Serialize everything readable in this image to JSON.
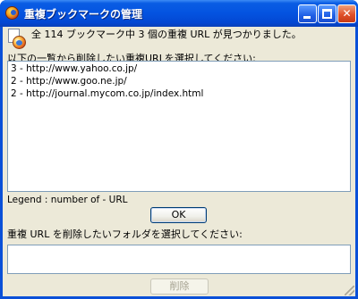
{
  "window": {
    "title": "重複ブックマークの管理",
    "buttons": {
      "minimize": "",
      "maximize": "",
      "close": "✕"
    }
  },
  "summary": "全 114 ブックマーク中 3 個の重複 URL が見つかりました。",
  "url_prompt": "以下の一覧から削除したい重複URLを選択してください:",
  "duplicates": [
    {
      "label": "3  -  http://www.yahoo.co.jp/"
    },
    {
      "label": "2  -  http://www.goo.ne.jp/"
    },
    {
      "label": "2  -  http://journal.mycom.co.jp/index.html"
    }
  ],
  "legend": "Legend : number of - URL",
  "ok_label": "OK",
  "folder_prompt": "重複 URL を削除したいフォルダを選択してください:",
  "delete_label": "削除",
  "colors": {
    "titlebar": "#0453e0",
    "client": "#ece9d8",
    "border": "#7f9db9"
  }
}
